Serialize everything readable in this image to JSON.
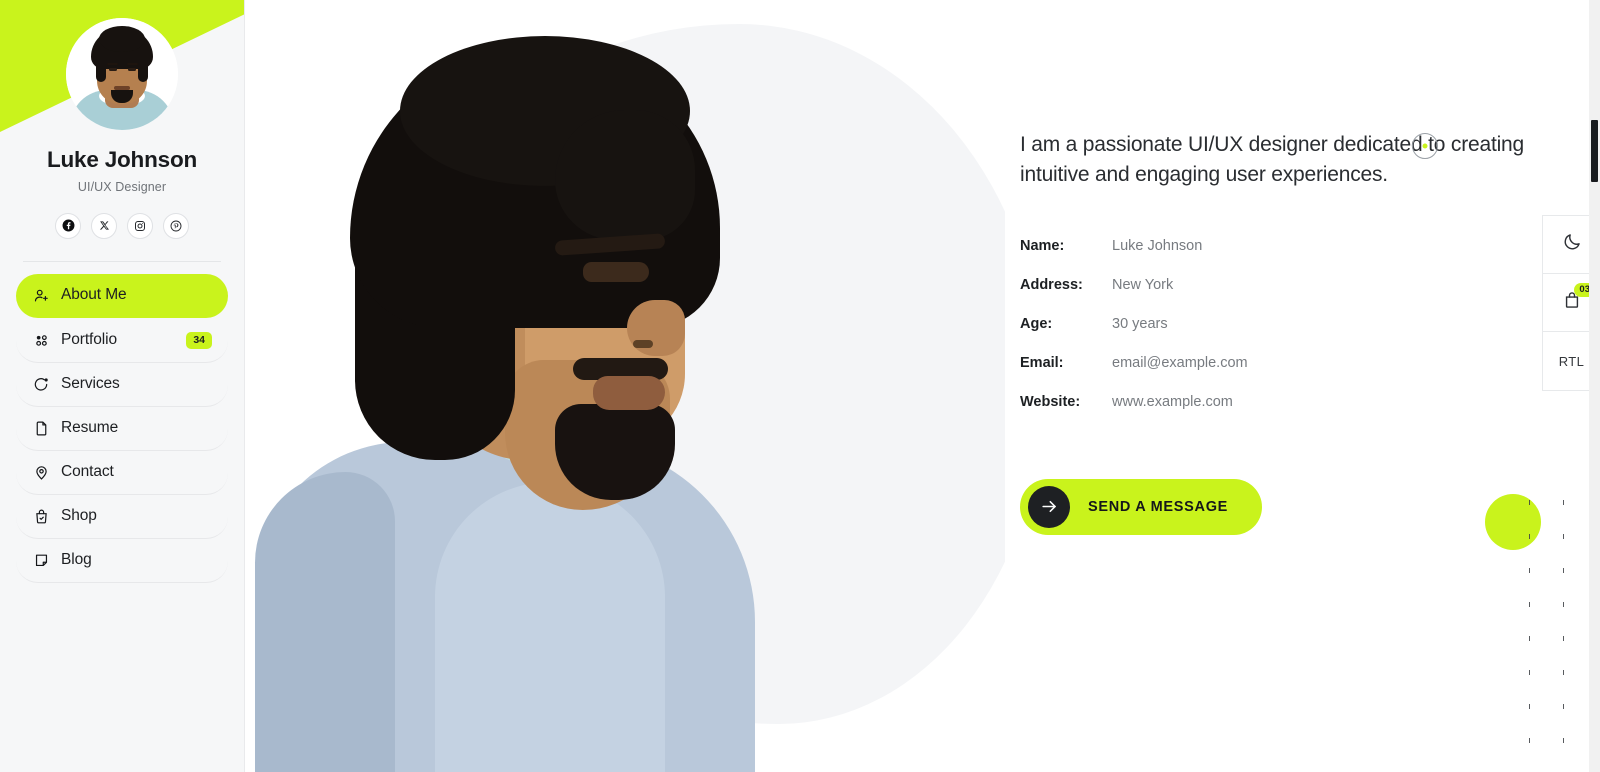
{
  "sidebar": {
    "profile": {
      "name": "Luke Johnson",
      "role": "UI/UX Designer",
      "avatar_alt": "avatar-photo"
    },
    "socials": [
      {
        "name": "facebook-icon",
        "label": "Facebook"
      },
      {
        "name": "x-twitter-icon",
        "label": "X"
      },
      {
        "name": "instagram-icon",
        "label": "Instagram"
      },
      {
        "name": "pinterest-icon",
        "label": "Pinterest"
      }
    ],
    "nav": [
      {
        "label": "About Me",
        "icon": "user-plus-icon",
        "active": true,
        "badge": ""
      },
      {
        "label": "Portfolio",
        "icon": "grid-dots-icon",
        "active": false,
        "badge": "34"
      },
      {
        "label": "Services",
        "icon": "service-arc-icon",
        "active": false,
        "badge": ""
      },
      {
        "label": "Resume",
        "icon": "pdf-file-icon",
        "active": false,
        "badge": ""
      },
      {
        "label": "Contact",
        "icon": "location-pin-icon",
        "active": false,
        "badge": ""
      },
      {
        "label": "Shop",
        "icon": "shopping-bag-icon",
        "active": false,
        "badge": ""
      },
      {
        "label": "Blog",
        "icon": "note-page-icon",
        "active": false,
        "badge": ""
      }
    ]
  },
  "main": {
    "intro": "I am a passionate UI/UX designer dedicated to creating intuitive and engaging user experiences.",
    "info": [
      {
        "label": "Name:",
        "value": "Luke Johnson"
      },
      {
        "label": "Address:",
        "value": "New York"
      },
      {
        "label": "Age:",
        "value": "30 years"
      },
      {
        "label": "Email:",
        "value": "email@example.com"
      },
      {
        "label": "Website:",
        "value": "www.example.com"
      }
    ],
    "send_button": {
      "label": "SEND A MESSAGE",
      "icon": "arrow-right-icon"
    }
  },
  "toolbar": {
    "items": [
      {
        "name": "dark-mode-toggle",
        "icon": "moon-icon",
        "text": "",
        "badge": ""
      },
      {
        "name": "cart-button",
        "icon": "shopping-bag-icon",
        "text": "",
        "badge": "03"
      },
      {
        "name": "rtl-toggle",
        "icon": "",
        "text": "RTL",
        "badge": ""
      }
    ]
  },
  "scroll_top": {
    "icon": "arrow-up-icon"
  },
  "colors": {
    "accent_green": "#c9f31c",
    "dark": "#1b1d20",
    "sidebar_bg": "#f6f7f8",
    "muted_text": "#777b80",
    "blob": "#f4f5f7"
  }
}
